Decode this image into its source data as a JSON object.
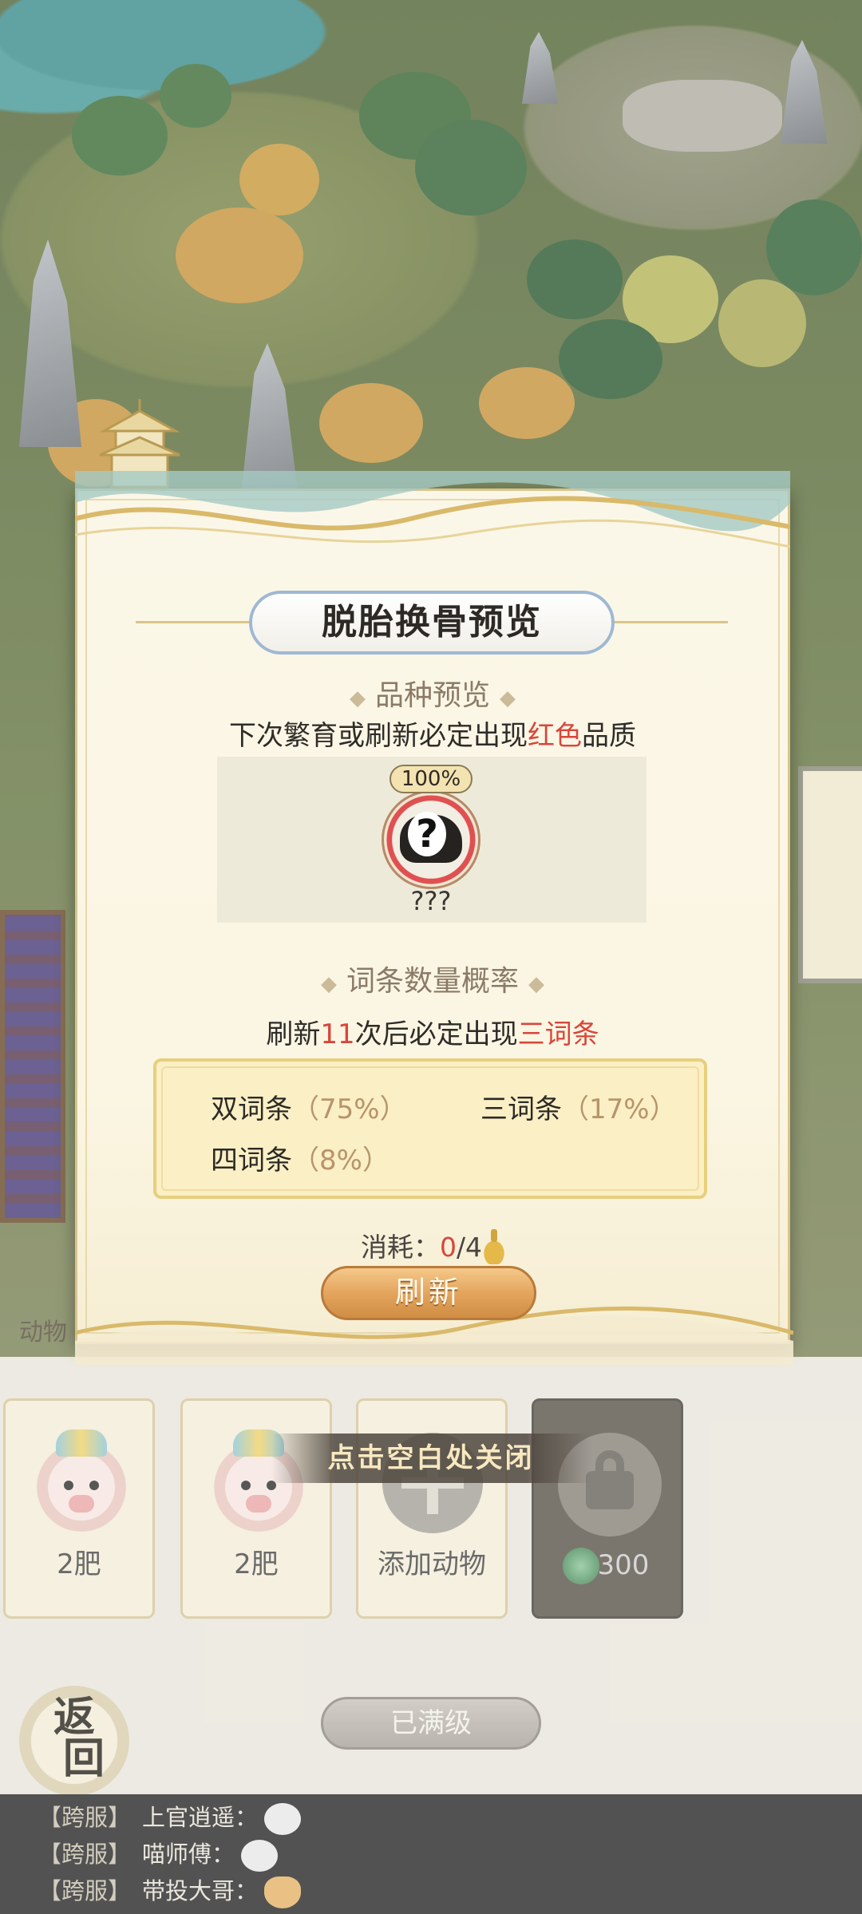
{
  "dialog": {
    "title": "脱胎换骨预览",
    "breed_section": {
      "heading": "品种预览",
      "desc_prefix": "下次繁育或刷新必定出现",
      "desc_highlight": "红色",
      "desc_suffix": "品质",
      "chance": "100%",
      "pet_name": "???"
    },
    "trait_section": {
      "heading": "词条数量概率",
      "desc_a": "刷新",
      "desc_count": "11",
      "desc_b": "次后必定出现",
      "desc_highlight": "三词条",
      "items": [
        {
          "label": "双词条",
          "pct": "（75%）"
        },
        {
          "label": "三词条",
          "pct": "（17%）"
        },
        {
          "label": "四词条",
          "pct": "（8%）"
        }
      ]
    },
    "cost_label": "消耗：",
    "cost_have": "0",
    "cost_need": "/4",
    "refresh_button": "刷新"
  },
  "overlay_tip": "点击空白处关闭",
  "side_label": "动物",
  "slots": [
    {
      "label": "2肥"
    },
    {
      "label": "2肥"
    },
    {
      "label": "添加动物"
    },
    {
      "label": "300"
    }
  ],
  "maxed_button": "已满级",
  "back_button": {
    "line1": "返",
    "line2": "回"
  },
  "chat": [
    {
      "server": "【跨服】",
      "name": "上官逍遥："
    },
    {
      "server": "【跨服】",
      "name": "喵师傅："
    },
    {
      "server": "【跨服】",
      "name": "带投大哥："
    }
  ],
  "colors": {
    "accent_red": "#d8463b",
    "gold": "#e2a25a",
    "frame": "#d9c48a"
  }
}
